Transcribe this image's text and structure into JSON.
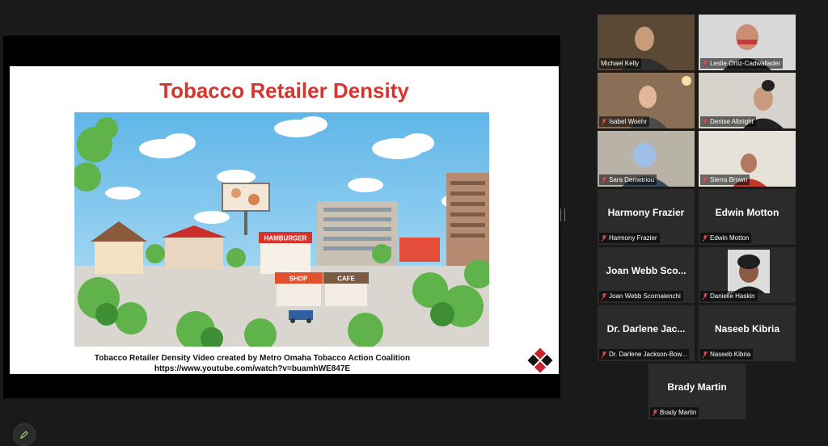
{
  "slide": {
    "title": "Tobacco Retailer Density",
    "caption_line1": "Tobacco Retailer Density Video created by Metro Omaha Tobacco Action Coalition",
    "caption_line2": "https://www.youtube.com/watch?v=buamhWE847E",
    "illustration_signs": [
      "HAMBURGER",
      "SHOP",
      "CAFE"
    ]
  },
  "participants": [
    {
      "name": "Michael Kelly",
      "video": true,
      "active": true
    },
    {
      "name": "Leslie Ortiz-Cadwallader",
      "video": true
    },
    {
      "name": "Isabel Woehr",
      "video": true
    },
    {
      "name": "Denise Albright",
      "video": true
    },
    {
      "name": "Sara Demetriou",
      "video": true
    },
    {
      "name": "Sierra Brown",
      "video": true
    },
    {
      "name": "Harmony Frazier",
      "display": "Harmony Frazier"
    },
    {
      "name": "Edwin Motton",
      "display": "Edwin Motton"
    },
    {
      "name": "Joan Webb Scornaienchi",
      "display": "Joan Webb Sco..."
    },
    {
      "name": "Danielle Haskin",
      "video": true
    },
    {
      "name": "Dr. Darlene Jackson-Bow...",
      "display": "Dr. Darlene Jac..."
    },
    {
      "name": "Naseeb Kibria",
      "display": "Naseeb Kibria"
    },
    {
      "name": "Brady Martin",
      "display": "Brady Martin"
    }
  ],
  "colors": {
    "accent_title": "#d6342d",
    "active_speaker": "#cdd326",
    "tile_bg": "#2b2b2b"
  },
  "icons": {
    "muted": "mic-muted-icon",
    "annotate": "pencil-icon"
  }
}
